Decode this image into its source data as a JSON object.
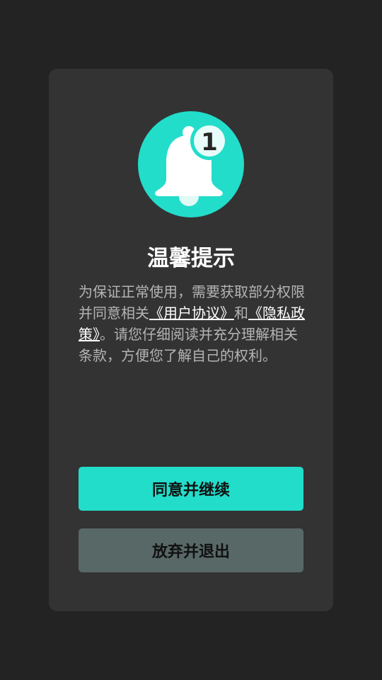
{
  "dialog": {
    "icon": "bell-notification-icon",
    "badge_count": "1",
    "title": "温馨提示",
    "text_before": "为保证正常使用，需要获取部分权限 并同意相关",
    "user_agreement_link": "《用户协议》",
    "text_and": "和",
    "privacy_policy_link": "《隐私政策》",
    "text_after": "。请您仔细阅读并充分理解相关条款，方便您了解自己的权利。",
    "agree_button_label": "同意并继续",
    "quit_button_label": "放弃并退出"
  },
  "colors": {
    "background": "#232323",
    "dialog": "#333333",
    "accent": "#22ddca",
    "secondary_button": "#586866"
  }
}
